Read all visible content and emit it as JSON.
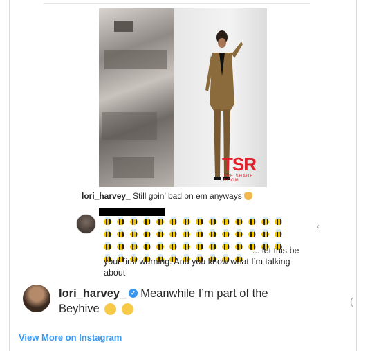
{
  "caption": {
    "username": "lori_harvey_",
    "text": "Still goin’ bad on em anyways"
  },
  "watermark": {
    "logo": "TSR",
    "sub": "THE SHADE ROOM"
  },
  "comment": {
    "text": "... let this be your first warning. And you know what I’m talking about"
  },
  "post": {
    "username": "lori_harvey_",
    "line1": "Meanwhile I’m part of the",
    "line2": "Beyhive"
  },
  "footer": {
    "view_more": "View More on Instagram"
  },
  "icons": {
    "verified": "verified-badge-icon",
    "caption_emoji": "cat-face-icon",
    "reaction_emojis": [
      "weary-face-icon",
      "tears-of-joy-icon"
    ],
    "bee": "honeybee-icon"
  },
  "colors": {
    "link": "#3897f0",
    "verified": "#3897f0",
    "brand_red": "#e0202b"
  }
}
